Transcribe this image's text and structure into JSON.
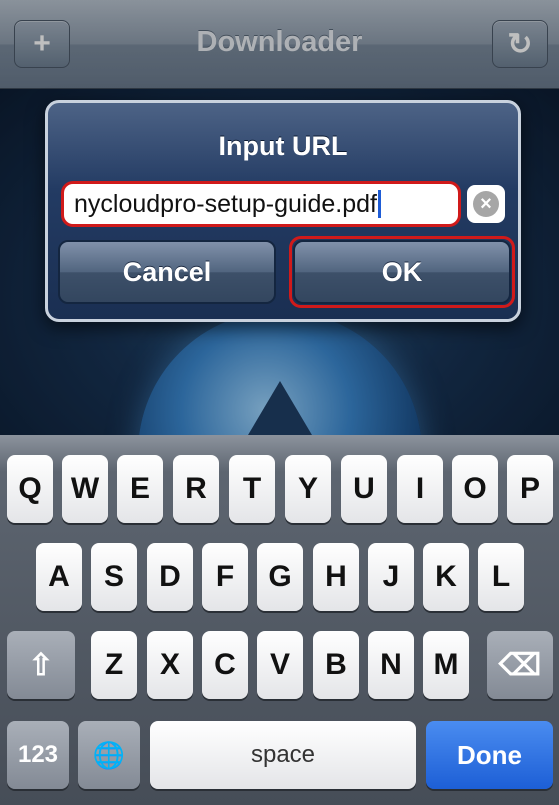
{
  "navbar": {
    "title": "Downloader",
    "left_button": "+",
    "left_icon": "add-icon",
    "right_button": "↻",
    "right_icon": "refresh-icon"
  },
  "alert": {
    "title": "Input URL",
    "url_value": "nycloudpro-setup-guide.pdf",
    "clear_icon": "clear-text-icon",
    "cancel_label": "Cancel",
    "ok_label": "OK"
  },
  "keyboard": {
    "row1": [
      "Q",
      "W",
      "E",
      "R",
      "T",
      "Y",
      "U",
      "I",
      "O",
      "P"
    ],
    "row2": [
      "A",
      "S",
      "D",
      "F",
      "G",
      "H",
      "J",
      "K",
      "L"
    ],
    "row3": [
      "Z",
      "X",
      "C",
      "V",
      "B",
      "N",
      "M"
    ],
    "shift_label": "⇧",
    "backspace_label": "⌫",
    "numbers_label": "123",
    "globe_label": "🌐",
    "space_label": "space",
    "done_label": "Done"
  },
  "colors": {
    "highlight": "#d01a1a",
    "done_key": "#1d5fd6",
    "alert_bg": "#233b63"
  }
}
